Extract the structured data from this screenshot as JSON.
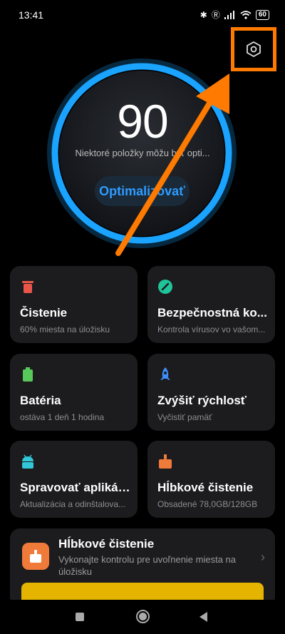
{
  "status_bar": {
    "time": "13:41",
    "battery": "60",
    "icons": [
      "bluetooth-icon",
      "registered-icon",
      "signal-icon",
      "wifi-icon",
      "battery-icon"
    ]
  },
  "score": {
    "value": "90",
    "message": "Niektoré položky môžu byť opti...",
    "optimize_label": "Optimalizovať"
  },
  "cards": [
    {
      "title": "Čistenie",
      "subtitle": "60% miesta na úložisku",
      "icon": "trash-icon",
      "color": "#e8564a"
    },
    {
      "title": "Bezpečnostná ko...",
      "subtitle": "Kontrola vírusov vo vašom...",
      "icon": "shield-check-icon",
      "color": "#1fc49a"
    },
    {
      "title": "Batéria",
      "subtitle": "ostáva 1 deň 1 hodina",
      "icon": "battery-icon",
      "color": "#57c95a"
    },
    {
      "title": "Zvýšiť rýchlosť",
      "subtitle": "Vyčistiť pamäť",
      "icon": "rocket-icon",
      "color": "#3e8ef7"
    },
    {
      "title": "Spravovať aplikácie",
      "subtitle": "Aktualizácia a odinštalova...",
      "icon": "android-icon",
      "color": "#32c6d6"
    },
    {
      "title": "Hĺbkové čistenie",
      "subtitle": "Obsadené 78,0GB/128GB",
      "icon": "broom-icon",
      "color": "#f07a3a"
    }
  ],
  "deep_clean": {
    "title": "Hĺbkové čistenie",
    "description": "Vykonajte kontrolu pre uvoľnenie miesta na úložisku",
    "icon": "broom-icon"
  },
  "colors": {
    "accent": "#2f9bff",
    "ring": "#1aa3ff",
    "highlight": "#ff7a00"
  }
}
